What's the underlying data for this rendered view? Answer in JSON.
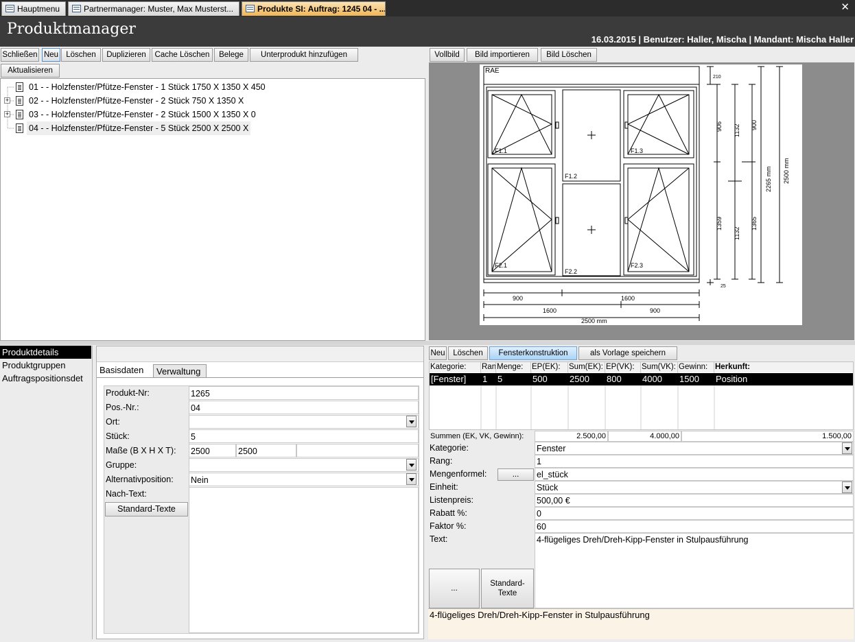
{
  "tabs": [
    {
      "label": "Hauptmenu"
    },
    {
      "label": "Partnermanager: Muster, Max Musterst..."
    },
    {
      "label": "Produkte SI: Auftrag: 1245 04 - ..."
    }
  ],
  "header": {
    "title": "Produktmanager",
    "status": "16.03.2015 | Benutzer: Haller, Mischa | Mandant: Mischa Haller"
  },
  "toolbar": {
    "close": "Schließen",
    "new": "Neu",
    "delete": "Löschen",
    "duplicate": "Duplizieren",
    "clear_cache": "Cache Löschen",
    "receipts": "Belege",
    "add_subproduct": "Unterprodukt hinzufügen",
    "refresh": "Aktualisieren"
  },
  "tree": {
    "items": [
      {
        "label": "01 -  - Holzfenster/Pfütze-Fenster - 1 Stück 1750 X 1350 X 450"
      },
      {
        "label": "02 -  - Holzfenster/Pfütze-Fenster - 2 Stück 750 X 1350 X"
      },
      {
        "label": "03 -  - Holzfenster/Pfütze-Fenster - 2 Stück 1500 X 1350 X 0"
      },
      {
        "label": "04 -  - Holzfenster/Pfütze-Fenster - 5 Stück 2500 X 2500 X"
      }
    ]
  },
  "image_toolbar": {
    "fullscreen": "Vollbild",
    "import": "Bild importieren",
    "delete": "Bild Löschen"
  },
  "drawing": {
    "header": "RAE",
    "sashes": [
      "F1.1",
      "F1.2",
      "F1.3",
      "F2.1",
      "F2.2",
      "F2.3"
    ],
    "dims_right": [
      "210",
      "906",
      "1132",
      "900",
      "2265 mm",
      "2500 mm",
      "1359",
      "1132",
      "1365",
      "25"
    ],
    "dims_bottom": [
      "900",
      "1600",
      "1600",
      "900",
      "2500 mm"
    ]
  },
  "nav": {
    "items": [
      "Produktdetails",
      "Produktgruppen",
      "Auftragspositionsdet"
    ]
  },
  "form_tabs": {
    "basis": "Basisdaten",
    "admin": "Verwaltung"
  },
  "form": {
    "product_no_label": "Produkt-Nr:",
    "product_no": "1265",
    "pos_no_label": "Pos.-Nr.:",
    "pos_no": "04",
    "location_label": "Ort:",
    "location": "",
    "pieces_label": "Stück:",
    "pieces": "5",
    "dims_label": "Maße (B X H X T):",
    "width": "2500",
    "height": "2500",
    "depth": "",
    "group_label": "Gruppe:",
    "group": "",
    "alt_label": "Alternativposition:",
    "alt": "Nein",
    "after_text_label": "Nach-Text:",
    "standard_texts": "Standard-Texte"
  },
  "pos_toolbar": {
    "new": "Neu",
    "delete": "Löschen",
    "construction": "Fensterkonstruktion",
    "save_template": "als Vorlage speichern"
  },
  "grid": {
    "columns": [
      "Kategorie:",
      "Rang",
      "Menge:",
      "EP(EK):",
      "Sum(EK):",
      "EP(VK):",
      "Sum(VK):",
      "Gewinn:",
      "Herkunft:"
    ],
    "row": [
      "[Fenster]",
      "1",
      "5",
      "500",
      "2500",
      "800",
      "4000",
      "1500",
      "Position"
    ]
  },
  "sums": {
    "label": "Summen (EK, VK, Gewinn):",
    "ek": "2.500,00",
    "vk": "4.000,00",
    "gain": "1.500,00"
  },
  "detail": {
    "category_label": "Kategorie:",
    "category": "Fenster",
    "rank_label": "Rang:",
    "rank": "1",
    "formula_label": "Mengenformel:",
    "formula_btn": "...",
    "formula": "el_stück",
    "unit_label": "Einheit:",
    "unit": "Stück",
    "list_price_label": "Listenpreis:",
    "list_price": "500,00 €",
    "discount_label": "Rabatt %:",
    "discount": "0",
    "factor_label": "Faktor %:",
    "factor": "60",
    "text_label": "Text:",
    "text": "4-flügeliges Dreh/Dreh-Kipp-Fenster in Stulpausführung",
    "dots_btn": "...",
    "std_btn_line1": "Standard-",
    "std_btn_line2": "Texte",
    "preview": "4-flügeliges Dreh/Dreh-Kipp-Fenster in Stulpausführung"
  }
}
